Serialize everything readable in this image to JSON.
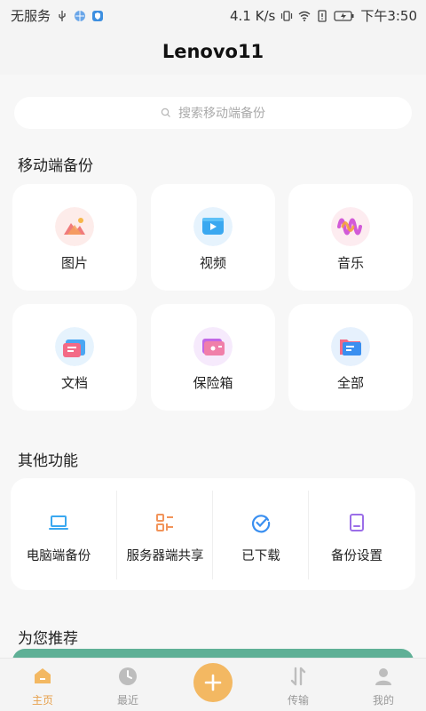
{
  "status_bar": {
    "carrier": "无服务",
    "speed": "4.1 K/s",
    "time": "下午3:50"
  },
  "app_bar": {
    "title": "Lenovo11"
  },
  "search": {
    "placeholder": "搜索移动端备份"
  },
  "mobile_backup": {
    "title": "移动端备份",
    "tiles": [
      {
        "label": "图片",
        "icon": "image-icon"
      },
      {
        "label": "视频",
        "icon": "video-icon"
      },
      {
        "label": "音乐",
        "icon": "music-icon"
      },
      {
        "label": "文档",
        "icon": "document-icon"
      },
      {
        "label": "保险箱",
        "icon": "safe-box-icon"
      },
      {
        "label": "全部",
        "icon": "folder-icon"
      }
    ]
  },
  "other_functions": {
    "title": "其他功能",
    "items": [
      {
        "label": "电脑端备份",
        "icon": "laptop-icon"
      },
      {
        "label": "服务器端共享",
        "icon": "share-grid-icon"
      },
      {
        "label": "已下载",
        "icon": "downloaded-check-icon"
      },
      {
        "label": "备份设置",
        "icon": "backup-settings-icon"
      }
    ]
  },
  "recommend": {
    "title": "为您推荐"
  },
  "tabbar": {
    "tabs": [
      {
        "label": "主页",
        "icon": "home-icon",
        "active": true
      },
      {
        "label": "最近",
        "icon": "clock-icon",
        "active": false
      },
      {
        "label": "传输",
        "icon": "transfer-icon",
        "active": false
      },
      {
        "label": "我的",
        "icon": "profile-icon",
        "active": false
      }
    ],
    "fab_icon": "plus-icon"
  },
  "colors": {
    "accent": "#f3b862",
    "active_tab": "#e7a04b",
    "recommend_banner": "#5fb096"
  }
}
